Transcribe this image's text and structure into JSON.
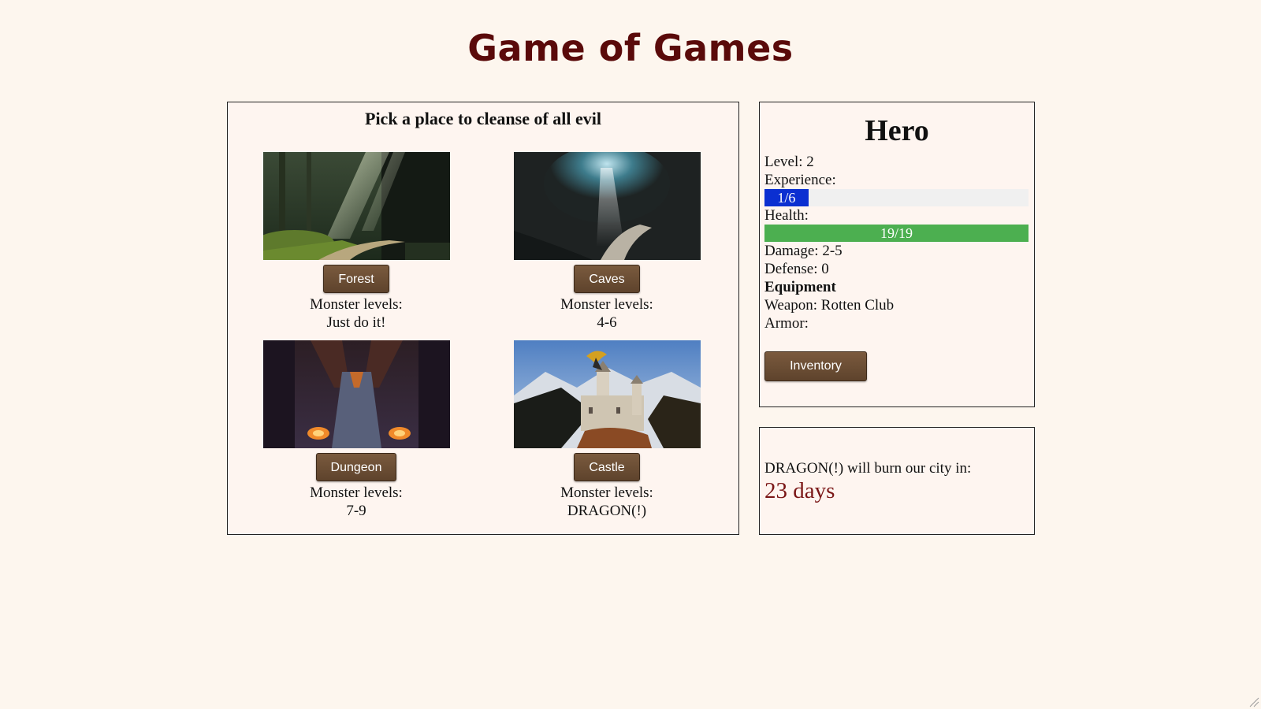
{
  "title": "Game of Games",
  "places": {
    "heading": "Pick a place to cleanse of all evil",
    "monster_levels_label": "Monster levels:",
    "items": [
      {
        "name": "Forest",
        "levels": "Just do it!"
      },
      {
        "name": "Caves",
        "levels": "4-6"
      },
      {
        "name": "Dungeon",
        "levels": "7-9"
      },
      {
        "name": "Castle",
        "levels": "DRAGON(!)"
      }
    ]
  },
  "hero": {
    "title": "Hero",
    "level_label": "Level: 2",
    "experience_label": "Experience:",
    "experience_text": "1/6",
    "experience_fraction": 0.1667,
    "health_label": "Health:",
    "health_text": "19/19",
    "health_fraction": 1.0,
    "damage_label": "Damage: 2-5",
    "defense_label": "Defense: 0",
    "equipment_heading": "Equipment",
    "weapon_label": "Weapon: Rotten Club",
    "armor_label": "Armor:",
    "inventory_button": "Inventory"
  },
  "timer": {
    "text": "DRAGON(!) will burn our city in:",
    "days": "23 days"
  },
  "colors": {
    "background": "#fdf6ee",
    "title": "#5a0a0a",
    "button": "#6b4d33",
    "experience_bar": "#0b2fd1",
    "health_bar": "#4caf50",
    "days_text": "#7a1616"
  }
}
